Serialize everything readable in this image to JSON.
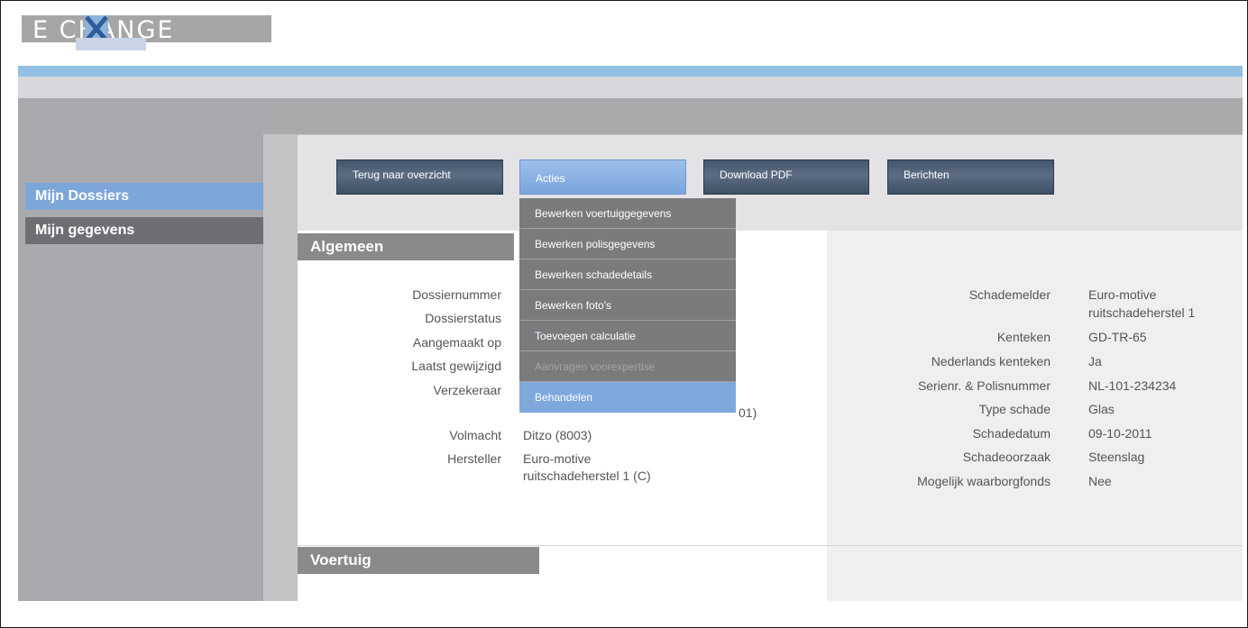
{
  "logo": {
    "text": "E   CHANGE"
  },
  "sidebar": {
    "items": [
      {
        "label": "Mijn Dossiers"
      },
      {
        "label": "Mijn gegevens"
      }
    ]
  },
  "toolbar": {
    "back_label": "Terug naar overzicht",
    "actions_label": "Acties",
    "download_label": "Download PDF",
    "messages_label": "Berichten"
  },
  "actions_menu": {
    "items": [
      {
        "label": "Bewerken voertuiggegevens"
      },
      {
        "label": "Bewerken polisgegevens"
      },
      {
        "label": "Bewerken schadedetails"
      },
      {
        "label": "Bewerken foto's"
      },
      {
        "label": "Toevoegen calculatie"
      },
      {
        "label": "Aanvragen voorexpertise"
      },
      {
        "label": "Behandelen"
      }
    ]
  },
  "sections": {
    "algemeen": "Algemeen",
    "voertuig": "Voertuig"
  },
  "general": {
    "dossiernummer_label": "Dossiernummer",
    "dossierstatus_label": "Dossierstatus",
    "aangemaakt_label": "Aangemaakt op",
    "gewijzigd_label": "Laatst gewijzigd",
    "verzekeraar_label": "Verzekeraar",
    "verzekeraar_value_tail": "01)",
    "volmacht_label": "Volmacht",
    "volmacht_value": "Ditzo (8003)",
    "hersteller_label": "Hersteller",
    "hersteller_value_1": "Euro-motive",
    "hersteller_value_2": "ruitschadeherstel 1 (C)"
  },
  "details": {
    "schademelder_label": "Schademelder",
    "schademelder_value_1": "Euro-motive",
    "schademelder_value_2": "ruitschadeherstel 1",
    "kenteken_label": "Kenteken",
    "kenteken_value": "GD-TR-65",
    "nl_kenteken_label": "Nederlands kenteken",
    "nl_kenteken_value": "Ja",
    "serienr_label": "Serienr. & Polisnummer",
    "serienr_value": "NL-101-234234",
    "type_label": "Type schade",
    "type_value": "Glas",
    "datum_label": "Schadedatum",
    "datum_value": "09-10-2011",
    "oorzaak_label": "Schadeoorzaak",
    "oorzaak_value": "Steenslag",
    "waarborg_label": "Mogelijk waarborgfonds",
    "waarborg_value": "Nee"
  },
  "colors": {
    "accent_blue": "#7da7d8",
    "header_bar": "#92c0e4",
    "button_dark": "#4b5c72"
  }
}
